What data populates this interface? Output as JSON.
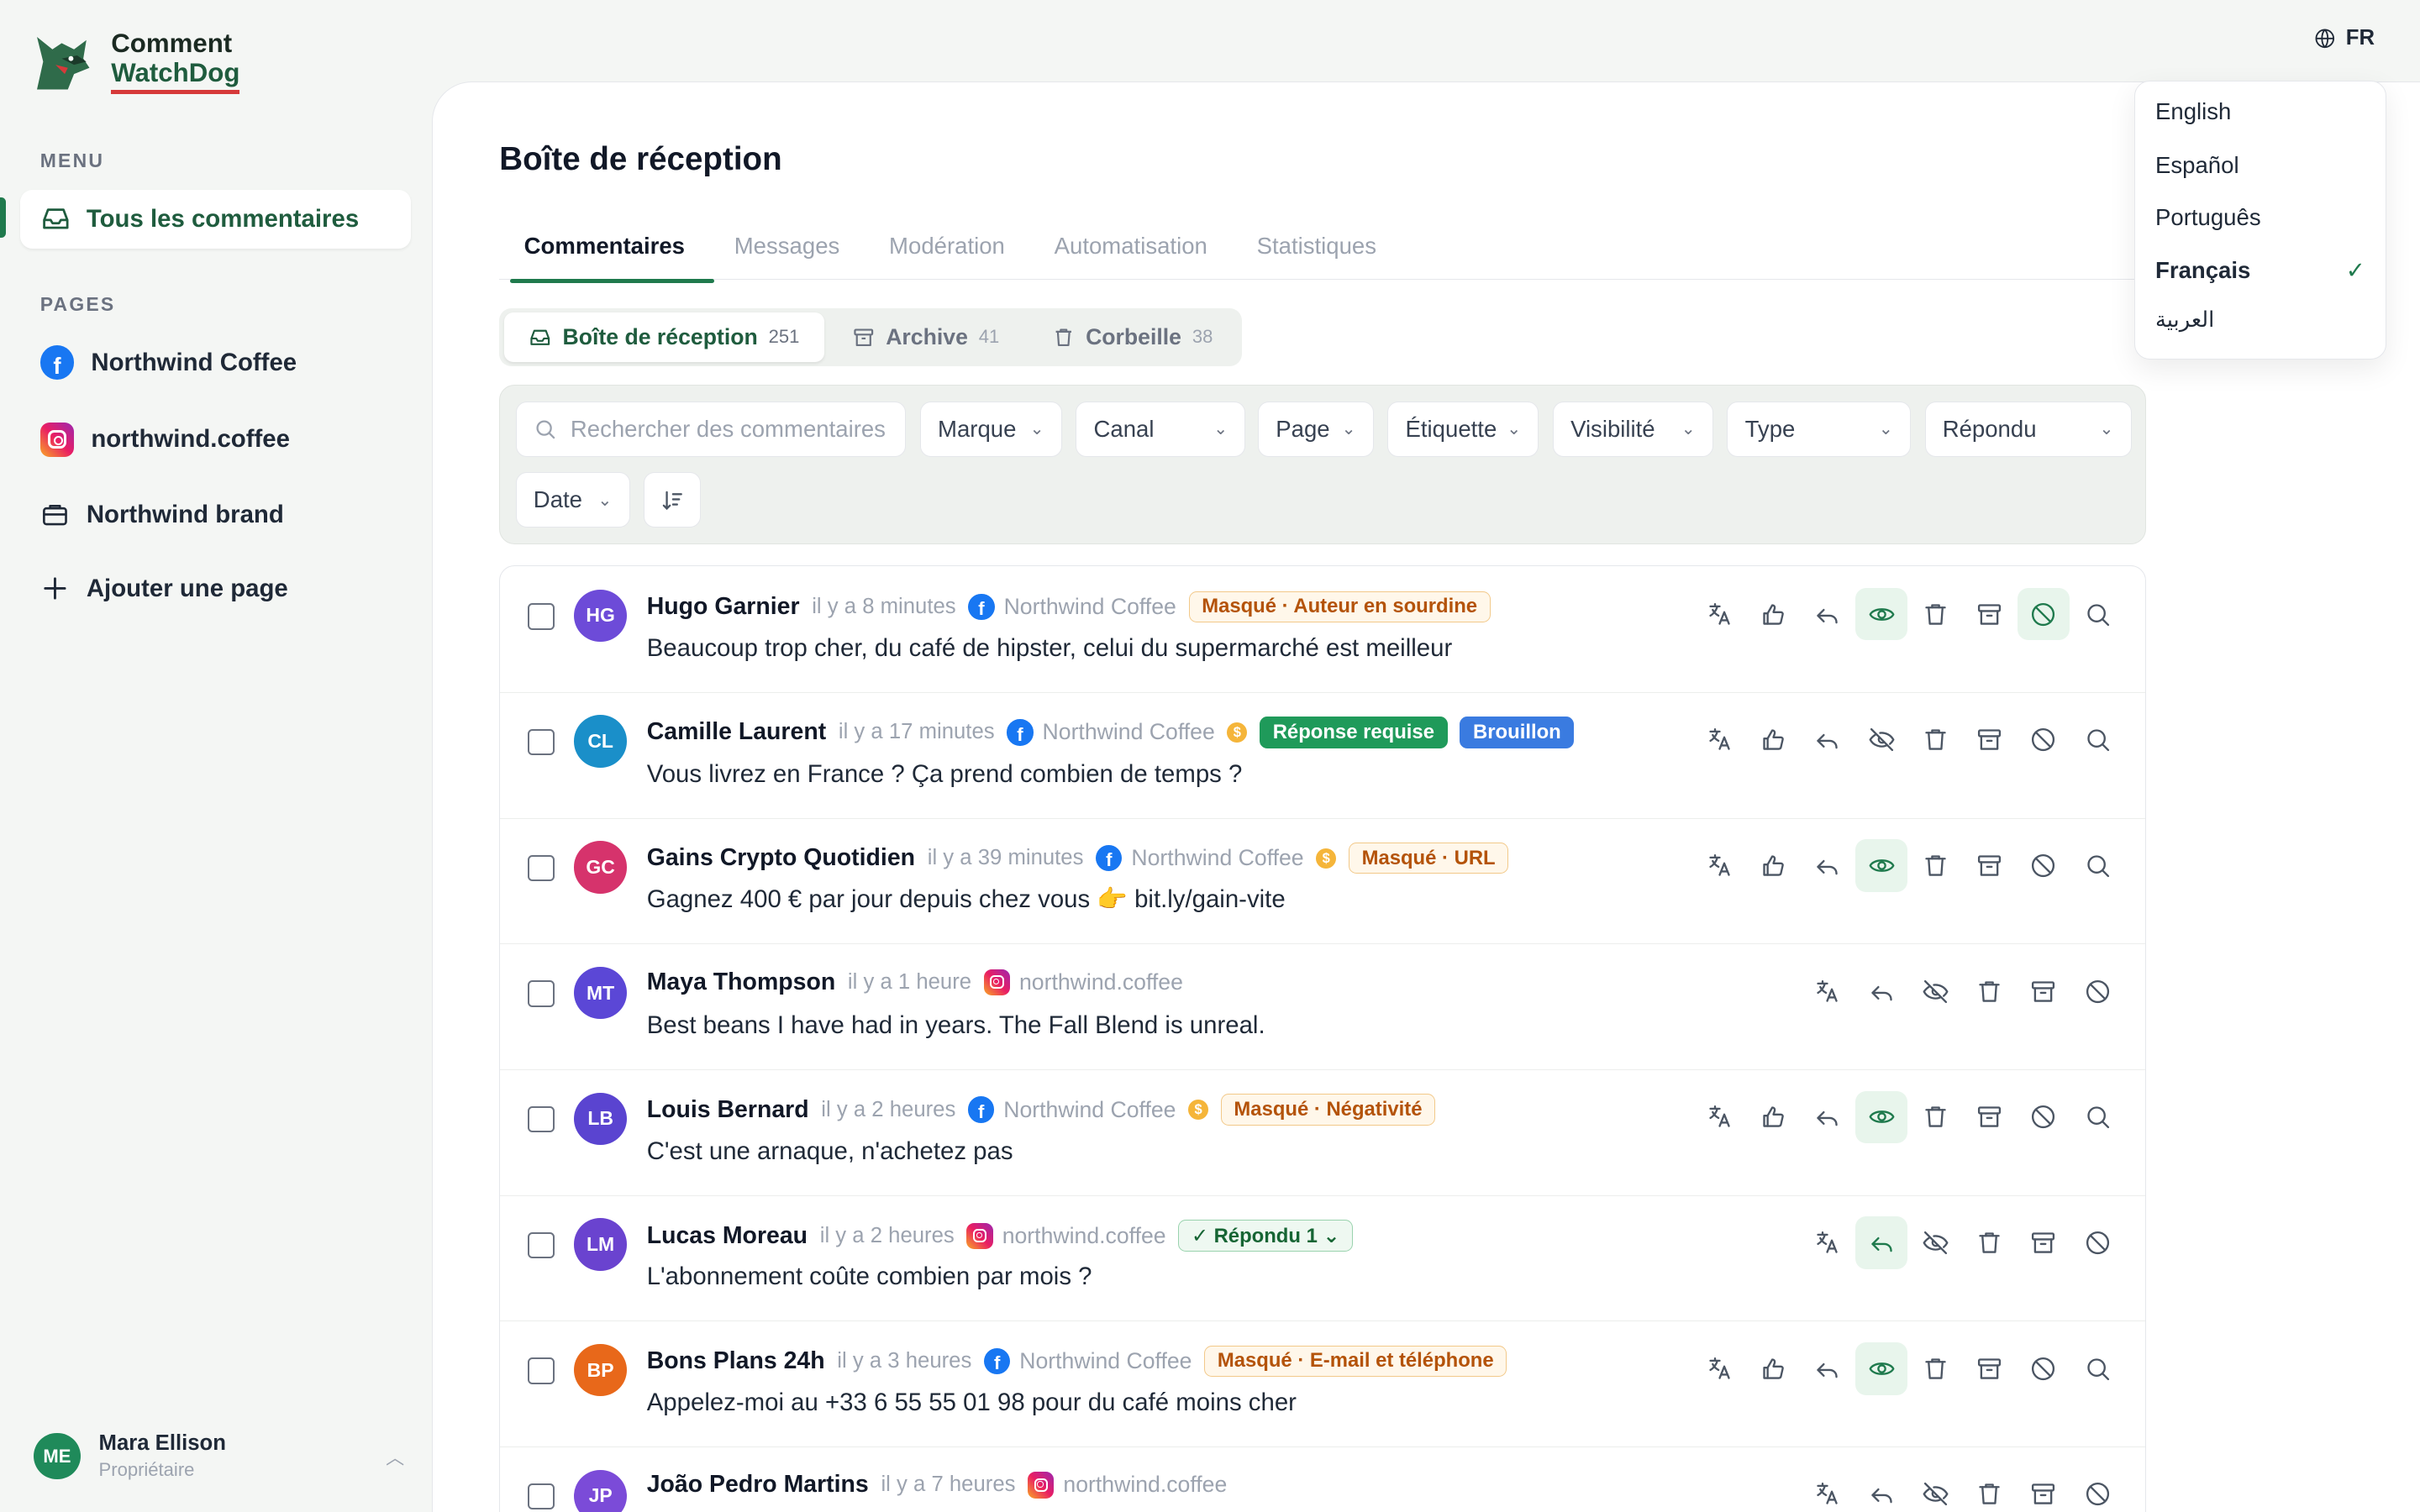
{
  "app": {
    "name_line1": "Comment",
    "name_line2": "WatchDog"
  },
  "sidebar": {
    "menu_label": "MENU",
    "active_item": "Tous les commentaires",
    "pages_label": "PAGES",
    "pages": [
      {
        "label": "Northwind Coffee",
        "icon": "facebook-icon"
      },
      {
        "label": "northwind.coffee",
        "icon": "instagram-icon"
      },
      {
        "label": "Northwind brand",
        "icon": "briefcase-icon"
      },
      {
        "label": "Ajouter une page",
        "icon": "plus-icon"
      }
    ],
    "user": {
      "initials": "ME",
      "name": "Mara Ellison",
      "role": "Propriétaire"
    }
  },
  "language": {
    "current": "FR",
    "options": [
      "English",
      "Español",
      "Português",
      "Français",
      "العربية"
    ],
    "selected": "Français"
  },
  "main": {
    "title": "Boîte de réception",
    "tabs": [
      "Commentaires",
      "Messages",
      "Modération",
      "Automatisation",
      "Statistiques"
    ],
    "active_tab": "Commentaires",
    "segments": [
      {
        "label": "Boîte de réception",
        "count": "251"
      },
      {
        "label": "Archive",
        "count": "41"
      },
      {
        "label": "Corbeille",
        "count": "38"
      }
    ],
    "filters": {
      "search_placeholder": "Rechercher des commentaires...",
      "dropdowns": [
        "Marque",
        "Canal",
        "Page",
        "Étiquette",
        "Visibilité",
        "Type",
        "Répondu",
        "Date"
      ]
    }
  },
  "comments": [
    {
      "initials": "HG",
      "name": "Hugo Garnier",
      "time": "il y a 8 minutes",
      "source": "Northwind Coffee",
      "platform": "facebook",
      "coin": false,
      "badges": [
        {
          "text": "Masqué · Auteur en sourdine",
          "style": "amber"
        }
      ],
      "text": "Beaucoup trop cher, du café de hipster, celui du supermarché est meilleur"
    },
    {
      "initials": "CL",
      "name": "Camille Laurent",
      "time": "il y a 17 minutes",
      "source": "Northwind Coffee",
      "platform": "facebook",
      "coin": true,
      "badges": [
        {
          "text": "Réponse requise",
          "style": "green"
        },
        {
          "text": "Brouillon",
          "style": "blue"
        }
      ],
      "text": "Vous livrez en France ? Ça prend combien de temps ?"
    },
    {
      "initials": "GC",
      "name": "Gains Crypto Quotidien",
      "time": "il y a 39 minutes",
      "source": "Northwind Coffee",
      "platform": "facebook",
      "coin": true,
      "badges": [
        {
          "text": "Masqué · URL",
          "style": "amber"
        }
      ],
      "text": "Gagnez 400 € par jour depuis chez vous 👉 bit.ly/gain-vite"
    },
    {
      "initials": "MT",
      "name": "Maya Thompson",
      "time": "il y a 1 heure",
      "source": "northwind.coffee",
      "platform": "instagram",
      "coin": false,
      "badges": [],
      "text": "Best beans I have had in years. The Fall Blend is unreal."
    },
    {
      "initials": "LB",
      "name": "Louis Bernard",
      "time": "il y a 2 heures",
      "source": "Northwind Coffee",
      "platform": "facebook",
      "coin": true,
      "badges": [
        {
          "text": "Masqué · Négativité",
          "style": "amber"
        }
      ],
      "text": "C'est une arnaque, n'achetez pas"
    },
    {
      "initials": "LM",
      "name": "Lucas Moreau",
      "time": "il y a 2 heures",
      "source": "northwind.coffee",
      "platform": "instagram",
      "coin": false,
      "badges": [
        {
          "text": "✓ Répondu 1 ⌄",
          "style": "replied"
        }
      ],
      "text": "L'abonnement coûte combien par mois ?"
    },
    {
      "initials": "BP",
      "name": "Bons Plans 24h",
      "time": "il y a 3 heures",
      "source": "Northwind Coffee",
      "platform": "facebook",
      "coin": false,
      "badges": [
        {
          "text": "Masqué · E-mail et téléphone",
          "style": "amber"
        }
      ],
      "text": "Appelez-moi au +33 6 55 55 01 98 pour du café moins cher"
    },
    {
      "initials": "JP",
      "name": "João Pedro Martins",
      "time": "il y a 7 heures",
      "source": "northwind.coffee",
      "platform": "instagram",
      "coin": false,
      "badges": [],
      "text": ""
    }
  ],
  "colors": {
    "accent": "#1f7a4d",
    "amber_badge": "#b45309",
    "green_badge": "#1f9a5a",
    "blue_badge": "#3a7be0"
  }
}
